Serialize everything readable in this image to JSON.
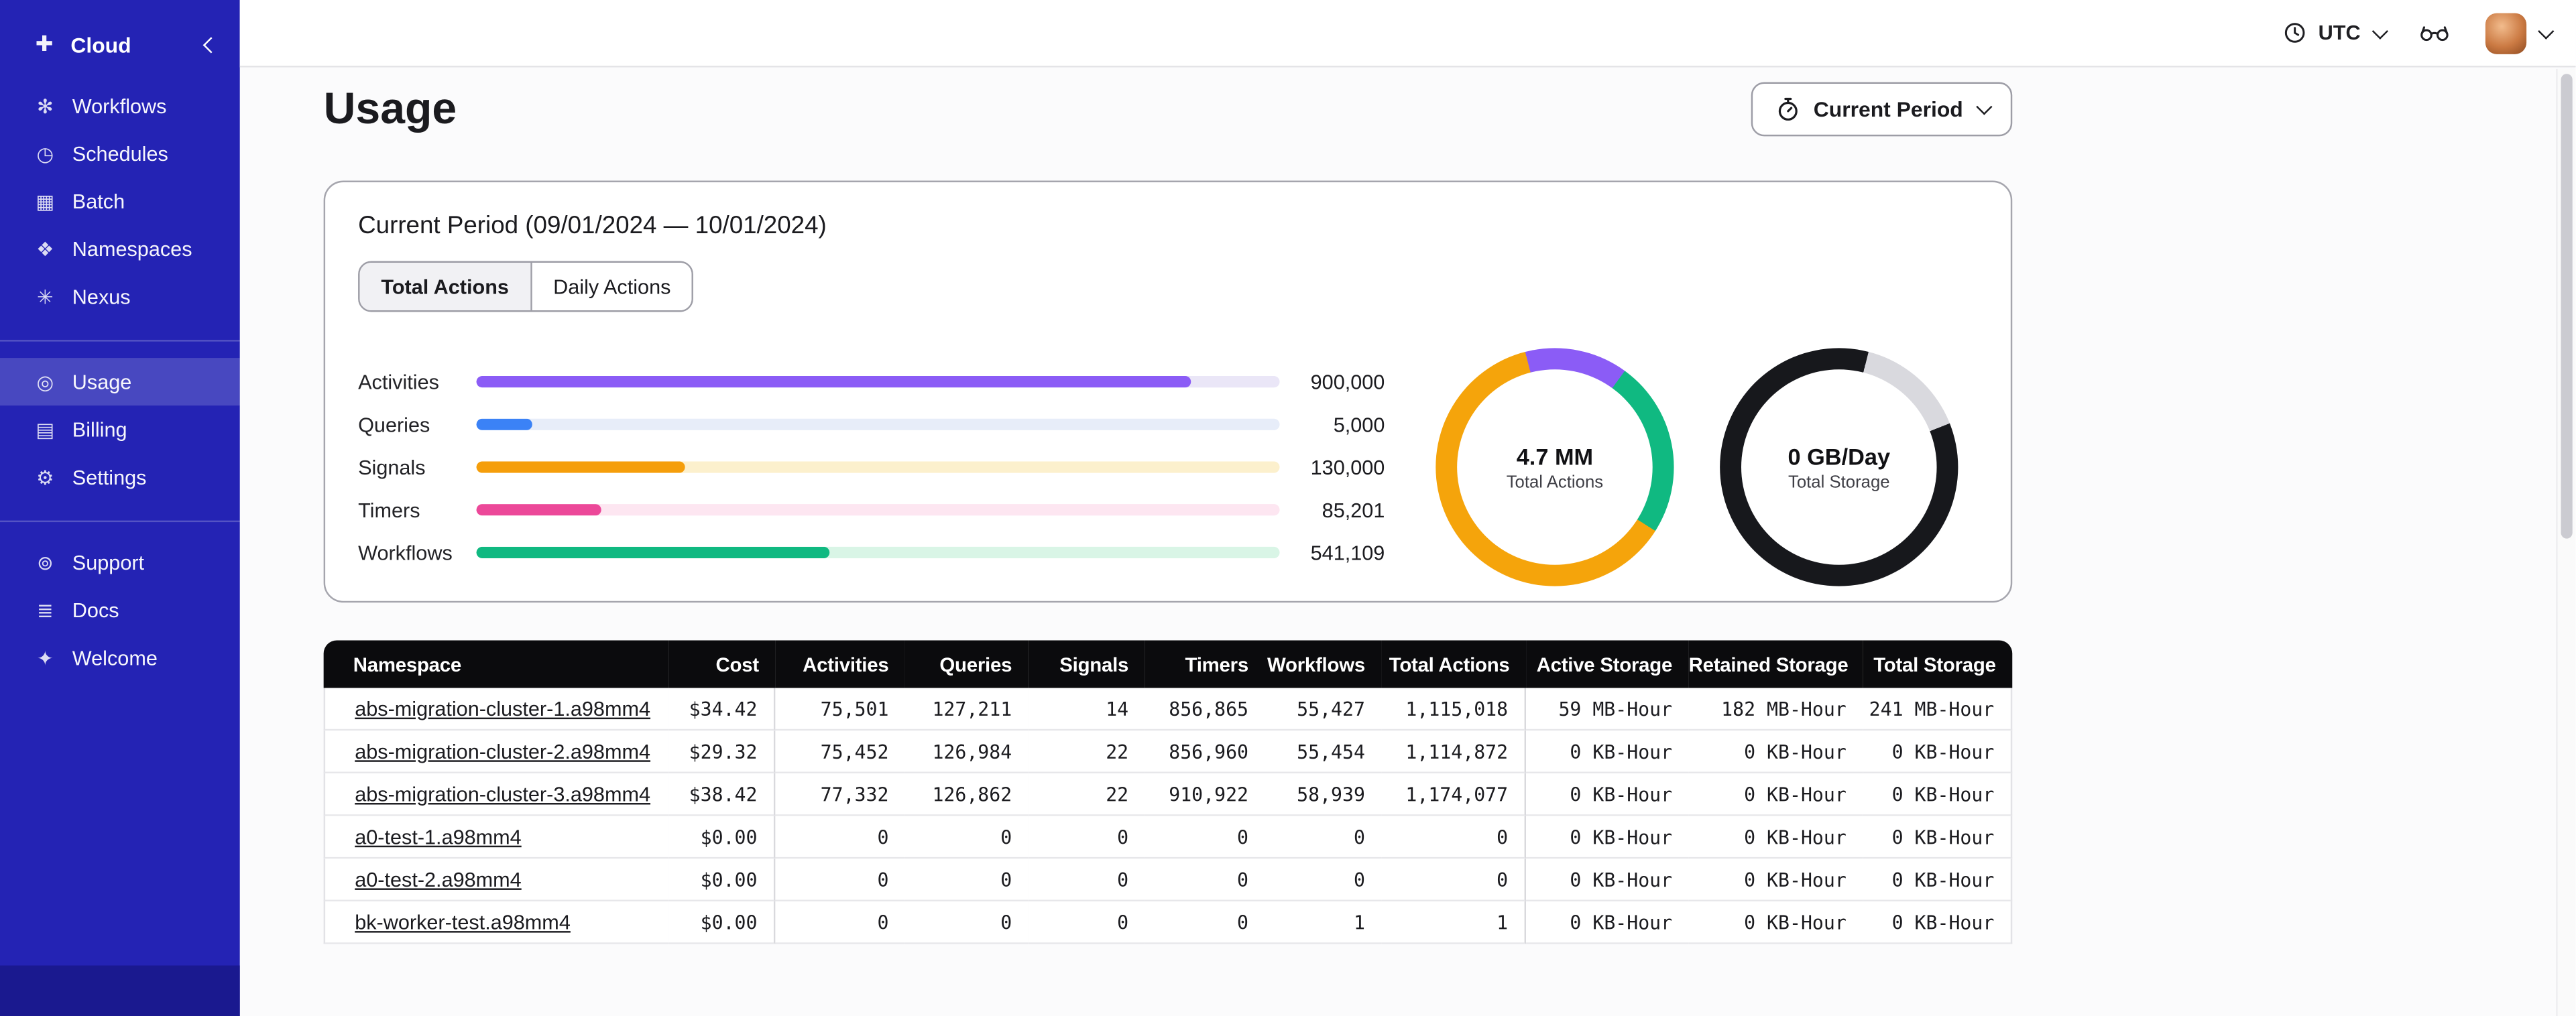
{
  "sidebar": {
    "brand": {
      "label": "Cloud",
      "glyph": "✚"
    },
    "nav_main": [
      {
        "label": "Workflows",
        "glyph": "✻"
      },
      {
        "label": "Schedules",
        "glyph": "◷"
      },
      {
        "label": "Batch",
        "glyph": "▦"
      },
      {
        "label": "Namespaces",
        "glyph": "❖"
      },
      {
        "label": "Nexus",
        "glyph": "✳"
      }
    ],
    "nav_account": [
      {
        "label": "Usage",
        "glyph": "◎"
      },
      {
        "label": "Billing",
        "glyph": "▤"
      },
      {
        "label": "Settings",
        "glyph": "⚙"
      }
    ],
    "nav_help": [
      {
        "label": "Support",
        "glyph": "⊚"
      },
      {
        "label": "Docs",
        "glyph": "≣"
      },
      {
        "label": "Welcome",
        "glyph": "✦"
      }
    ]
  },
  "topbar": {
    "timezone": "UTC"
  },
  "page": {
    "title": "Usage",
    "period_button_label": "Current Period"
  },
  "usage_card": {
    "title": "Current Period (09/01/2024 — 10/01/2024)",
    "tab_total": "Total Actions",
    "tab_daily": "Daily Actions"
  },
  "chart_data": {
    "type": "bar",
    "bars": [
      {
        "label": "Activities",
        "value": 900000,
        "value_label": "900,000",
        "fill_width": "89%",
        "color": "#8b5cf6",
        "track_color": "#eae6f7"
      },
      {
        "label": "Queries",
        "value": 5000,
        "value_label": "5,000",
        "fill_width": "7%",
        "color": "#3b82f6",
        "track_color": "#e7edf9"
      },
      {
        "label": "Signals",
        "value": 130000,
        "value_label": "130,000",
        "fill_width": "26%",
        "color": "#f59e0b",
        "track_color": "#fcf0cd"
      },
      {
        "label": "Timers",
        "value": 85201,
        "value_label": "85,201",
        "fill_width": "15.5%",
        "color": "#ec4899",
        "track_color": "#fde6f1"
      },
      {
        "label": "Workflows",
        "value": 541109,
        "value_label": "541,109",
        "fill_width": "44%",
        "color": "#10b981",
        "track_color": "#d9f5e6"
      }
    ],
    "donuts": [
      {
        "center_value": "4.7 MM",
        "center_label": "Total Actions",
        "segments": [
          {
            "color": "#8b5cf6",
            "pct": 10
          },
          {
            "color": "#10b981",
            "pct": 24
          },
          {
            "color": "#f5a40b",
            "pct": 62
          },
          {
            "color": "#8b5cf6",
            "pct": 4
          }
        ]
      },
      {
        "center_value": "0 GB/Day",
        "center_label": "Total Storage",
        "segments": [
          {
            "color": "#17181c",
            "pct": 4
          },
          {
            "color": "#d9d9de",
            "pct": 15
          },
          {
            "color": "#17181c",
            "pct": 81
          }
        ]
      }
    ]
  },
  "table": {
    "columns": [
      "Namespace",
      "Cost",
      "Activities",
      "Queries",
      "Signals",
      "Timers",
      "Workflows",
      "Total Actions",
      "Active Storage",
      "Retained Storage",
      "Total Storage"
    ],
    "rows": [
      {
        "namespace": "abs-migration-cluster-1.a98mm4",
        "cost": "$34.42",
        "activities": "75,501",
        "queries": "127,211",
        "signals": "14",
        "timers": "856,865",
        "workflows": "55,427",
        "total_actions": "1,115,018",
        "active_storage": "59 MB-Hour",
        "retained_storage": "182 MB-Hour",
        "total_storage": "241 MB-Hour"
      },
      {
        "namespace": "abs-migration-cluster-2.a98mm4",
        "cost": "$29.32",
        "activities": "75,452",
        "queries": "126,984",
        "signals": "22",
        "timers": "856,960",
        "workflows": "55,454",
        "total_actions": "1,114,872",
        "active_storage": "0 KB-Hour",
        "retained_storage": "0 KB-Hour",
        "total_storage": "0 KB-Hour"
      },
      {
        "namespace": "abs-migration-cluster-3.a98mm4",
        "cost": "$38.42",
        "activities": "77,332",
        "queries": "126,862",
        "signals": "22",
        "timers": "910,922",
        "workflows": "58,939",
        "total_actions": "1,174,077",
        "active_storage": "0 KB-Hour",
        "retained_storage": "0 KB-Hour",
        "total_storage": "0 KB-Hour"
      },
      {
        "namespace": "a0-test-1.a98mm4",
        "cost": "$0.00",
        "activities": "0",
        "queries": "0",
        "signals": "0",
        "timers": "0",
        "workflows": "0",
        "total_actions": "0",
        "active_storage": "0 KB-Hour",
        "retained_storage": "0 KB-Hour",
        "total_storage": "0 KB-Hour"
      },
      {
        "namespace": "a0-test-2.a98mm4",
        "cost": "$0.00",
        "activities": "0",
        "queries": "0",
        "signals": "0",
        "timers": "0",
        "workflows": "0",
        "total_actions": "0",
        "active_storage": "0 KB-Hour",
        "retained_storage": "0 KB-Hour",
        "total_storage": "0 KB-Hour"
      },
      {
        "namespace": "bk-worker-test.a98mm4",
        "cost": "$0.00",
        "activities": "0",
        "queries": "0",
        "signals": "0",
        "timers": "0",
        "workflows": "1",
        "total_actions": "1",
        "active_storage": "0 KB-Hour",
        "retained_storage": "0 KB-Hour",
        "total_storage": "0 KB-Hour"
      }
    ]
  }
}
